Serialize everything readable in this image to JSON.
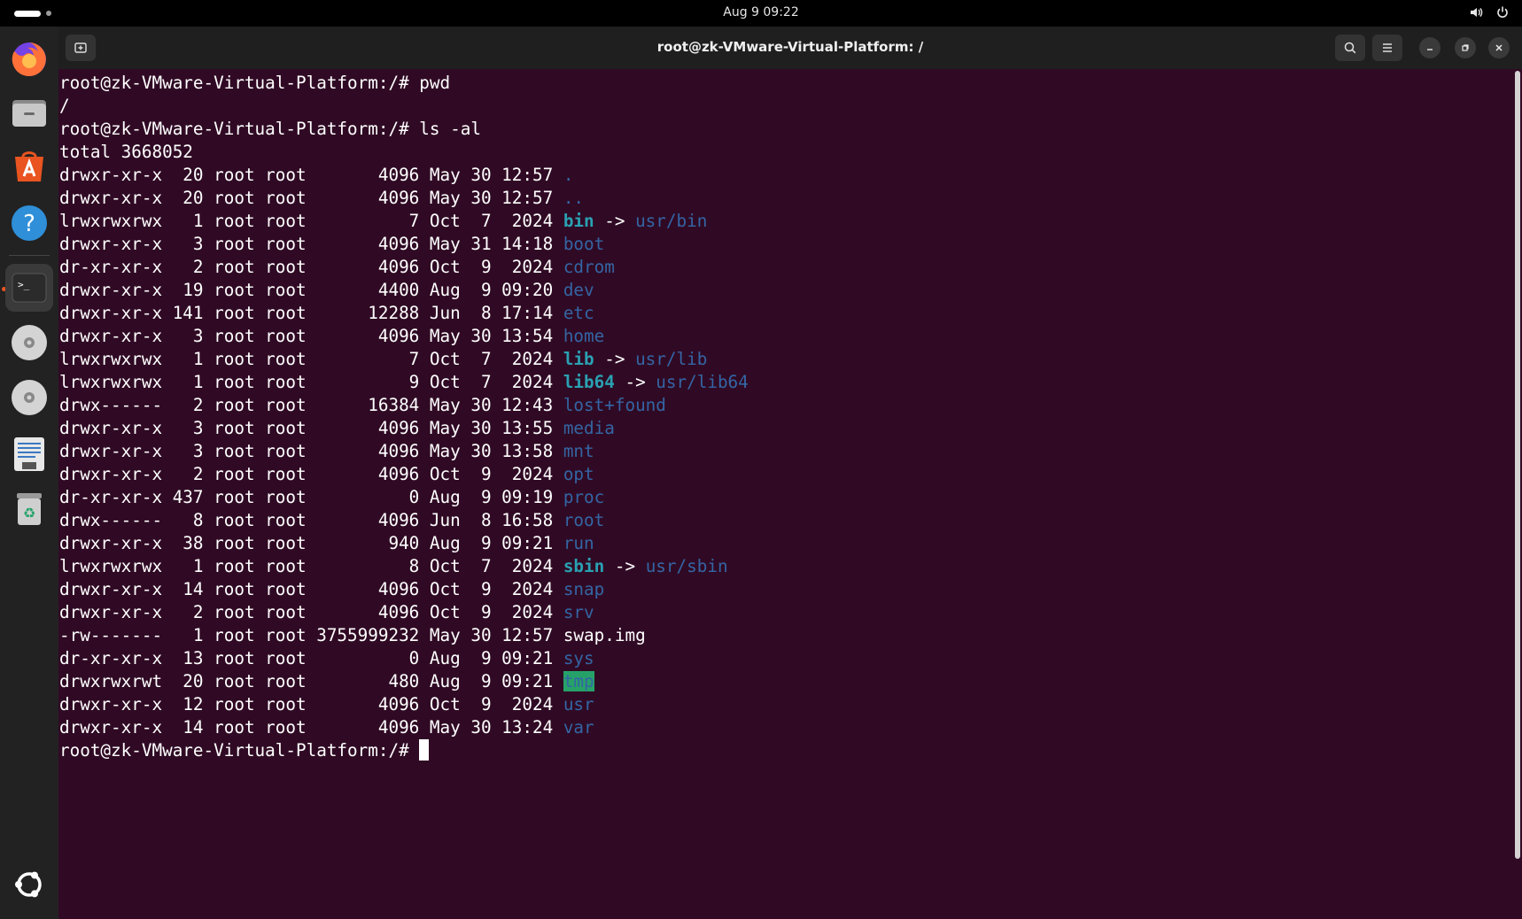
{
  "topbar": {
    "clock": "Aug 9  09:22",
    "icons": [
      "volume-icon",
      "power-icon"
    ]
  },
  "dock": {
    "items": [
      {
        "name": "firefox",
        "icon": "firefox-icon"
      },
      {
        "name": "files",
        "icon": "folder-icon"
      },
      {
        "name": "app-center",
        "icon": "app-store-icon"
      },
      {
        "name": "help",
        "icon": "help-icon"
      },
      {
        "name": "terminal",
        "icon": "terminal-icon",
        "active": true
      },
      {
        "name": "disc-1",
        "icon": "disc-icon"
      },
      {
        "name": "disc-2",
        "icon": "disc-icon"
      },
      {
        "name": "text-editor",
        "icon": "document-icon"
      },
      {
        "name": "trash",
        "icon": "trash-icon"
      },
      {
        "name": "show-apps",
        "icon": "ubuntu-logo-icon"
      }
    ]
  },
  "window": {
    "title": "root@zk-VMware-Virtual-Platform: /"
  },
  "terminal": {
    "prompt": "root@zk-VMware-Virtual-Platform:/# ",
    "cmd1": "pwd",
    "out1": "/",
    "cmd2": "ls -al",
    "total": "total 3668052",
    "listing": [
      {
        "meta": "drwxr-xr-x  20 root root       4096 May 30 12:57 ",
        "name": ".",
        "kind": "dir"
      },
      {
        "meta": "drwxr-xr-x  20 root root       4096 May 30 12:57 ",
        "name": "..",
        "kind": "dir"
      },
      {
        "meta": "lrwxrwxrwx   1 root root          7 Oct  7  2024 ",
        "name": "bin",
        "kind": "link",
        "target": "usr/bin"
      },
      {
        "meta": "drwxr-xr-x   3 root root       4096 May 31 14:18 ",
        "name": "boot",
        "kind": "dir"
      },
      {
        "meta": "dr-xr-xr-x   2 root root       4096 Oct  9  2024 ",
        "name": "cdrom",
        "kind": "dir"
      },
      {
        "meta": "drwxr-xr-x  19 root root       4400 Aug  9 09:20 ",
        "name": "dev",
        "kind": "dir"
      },
      {
        "meta": "drwxr-xr-x 141 root root      12288 Jun  8 17:14 ",
        "name": "etc",
        "kind": "dir"
      },
      {
        "meta": "drwxr-xr-x   3 root root       4096 May 30 13:54 ",
        "name": "home",
        "kind": "dir"
      },
      {
        "meta": "lrwxrwxrwx   1 root root          7 Oct  7  2024 ",
        "name": "lib",
        "kind": "link",
        "target": "usr/lib"
      },
      {
        "meta": "lrwxrwxrwx   1 root root          9 Oct  7  2024 ",
        "name": "lib64",
        "kind": "link",
        "target": "usr/lib64"
      },
      {
        "meta": "drwx------   2 root root      16384 May 30 12:43 ",
        "name": "lost+found",
        "kind": "dir"
      },
      {
        "meta": "drwxr-xr-x   3 root root       4096 May 30 13:55 ",
        "name": "media",
        "kind": "dir"
      },
      {
        "meta": "drwxr-xr-x   3 root root       4096 May 30 13:58 ",
        "name": "mnt",
        "kind": "dir"
      },
      {
        "meta": "drwxr-xr-x   2 root root       4096 Oct  9  2024 ",
        "name": "opt",
        "kind": "dir"
      },
      {
        "meta": "dr-xr-xr-x 437 root root          0 Aug  9 09:19 ",
        "name": "proc",
        "kind": "dir"
      },
      {
        "meta": "drwx------   8 root root       4096 Jun  8 16:58 ",
        "name": "root",
        "kind": "dir"
      },
      {
        "meta": "drwxr-xr-x  38 root root        940 Aug  9 09:21 ",
        "name": "run",
        "kind": "dir"
      },
      {
        "meta": "lrwxrwxrwx   1 root root          8 Oct  7  2024 ",
        "name": "sbin",
        "kind": "link",
        "target": "usr/sbin"
      },
      {
        "meta": "drwxr-xr-x  14 root root       4096 Oct  9  2024 ",
        "name": "snap",
        "kind": "dir"
      },
      {
        "meta": "drwxr-xr-x   2 root root       4096 Oct  9  2024 ",
        "name": "srv",
        "kind": "dir"
      },
      {
        "meta": "-rw-------   1 root root 3755999232 May 30 12:57 ",
        "name": "swap.img",
        "kind": "file"
      },
      {
        "meta": "dr-xr-xr-x  13 root root          0 Aug  9 09:21 ",
        "name": "sys",
        "kind": "dir"
      },
      {
        "meta": "drwxrwxrwt  20 root root        480 Aug  9 09:21 ",
        "name": "tmp",
        "kind": "sticky"
      },
      {
        "meta": "drwxr-xr-x  12 root root       4096 Oct  9  2024 ",
        "name": "usr",
        "kind": "dir"
      },
      {
        "meta": "drwxr-xr-x  14 root root       4096 May 30 13:24 ",
        "name": "var",
        "kind": "dir"
      }
    ],
    "link_arrow": " -> "
  },
  "colors": {
    "terminal_bg": "#300a24",
    "dir": "#3465a4",
    "link": "#2aa1b3",
    "sticky_bg": "#26a269",
    "accent": "#e95420"
  }
}
